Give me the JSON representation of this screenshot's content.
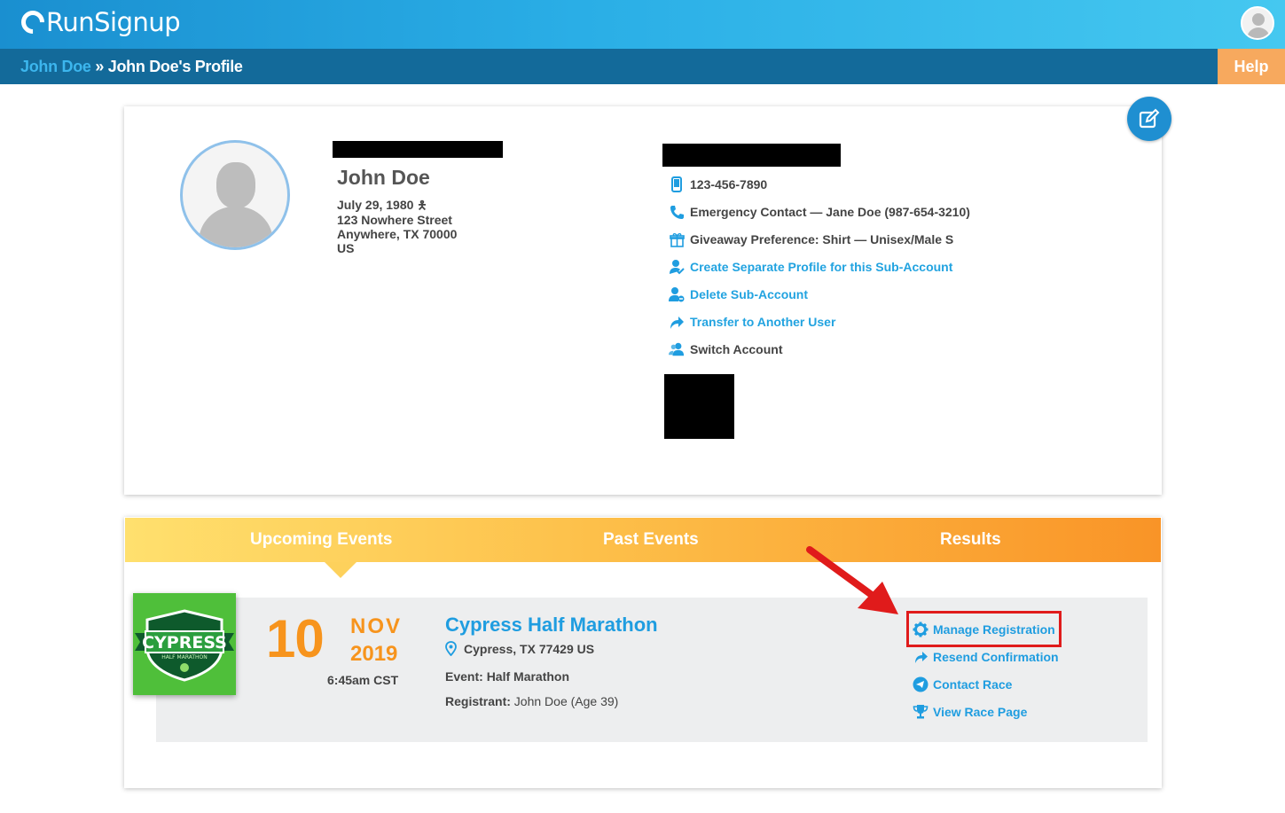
{
  "header": {
    "logo_text": "RunSignup",
    "user_avatar_icon": "user-avatar-icon"
  },
  "breadcrumb": {
    "link": "John Doe",
    "separator": "»",
    "current": "John Doe's Profile",
    "help_label": "Help"
  },
  "profile": {
    "name": "John Doe",
    "dob": "July 29, 1980",
    "gender_icon": "male-icon",
    "address_line1": "123 Nowhere Street",
    "address_line2": "Anywhere, TX 70000",
    "country": "US",
    "phone": "123-456-7890",
    "emergency_contact": "Emergency Contact — Jane Doe (987-654-3210)",
    "giveaway": "Giveaway Preference: Shirt — Unisex/Male S",
    "actions": [
      {
        "label": "Create Separate Profile for this Sub-Account",
        "icon": "user-check-icon"
      },
      {
        "label": "Delete Sub-Account",
        "icon": "user-minus-icon"
      },
      {
        "label": "Transfer to Another User",
        "icon": "share-arrow-icon"
      },
      {
        "label": "Switch Account",
        "icon": "users-icon"
      }
    ]
  },
  "events": {
    "tabs": [
      "Upcoming Events",
      "Past Events",
      "Results"
    ],
    "active_tab": "Upcoming Events",
    "items": [
      {
        "logo_text": "CYPRESS",
        "logo_subtext": "HALF MARATHON",
        "day": "10",
        "month": "NOV",
        "year": "2019",
        "time": "6:45am CST",
        "title": "Cypress Half Marathon",
        "location": "Cypress, TX 77429 US",
        "event_label": "Event:",
        "event_value": "Half Marathon",
        "registrant_label": "Registrant:",
        "registrant_value": "John Doe (Age 39)",
        "actions": [
          {
            "label": "Manage Registration",
            "icon": "gear-icon"
          },
          {
            "label": "Resend Confirmation",
            "icon": "reply-arrow-icon"
          },
          {
            "label": "Contact Race",
            "icon": "send-icon"
          },
          {
            "label": "View Race Page",
            "icon": "trophy-icon"
          }
        ]
      }
    ]
  },
  "colors": {
    "header_blue": "#2aaee6",
    "crumb_bar": "#136a9a",
    "help_orange": "#f7a95e",
    "link_blue": "#22a3e0",
    "date_orange": "#f7941d",
    "annotation_red": "#e01b1b"
  }
}
